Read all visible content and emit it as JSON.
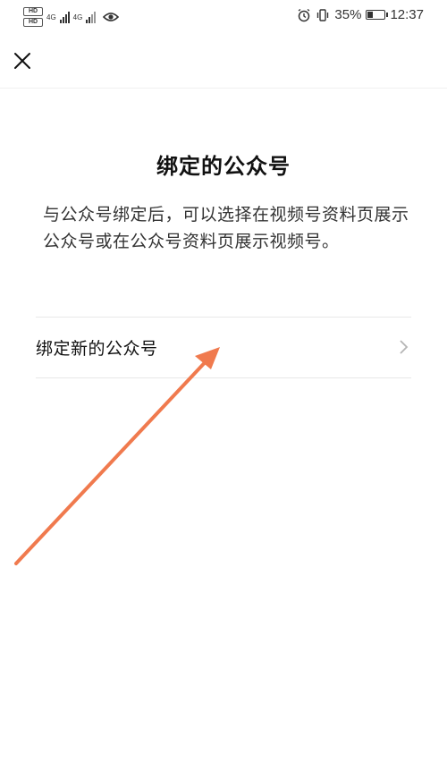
{
  "status_bar": {
    "hd_label_1": "HD",
    "hd_label_2": "HD",
    "network_1": "4G",
    "network_2": "4G",
    "battery_percent": "35%",
    "battery_level": 0.35,
    "time": "12:37",
    "icons": [
      "eye-icon",
      "alarm-icon",
      "vibrate-icon",
      "battery-icon"
    ]
  },
  "header": {
    "close_icon": "close-icon"
  },
  "main": {
    "title": "绑定的公众号",
    "description": "与公众号绑定后，可以选择在视频号资料页展示公众号或在公众号资料页展示视频号。",
    "bind_row_label": "绑定新的公众号",
    "bind_row_icon": "chevron-right-icon"
  },
  "colors": {
    "annotation_arrow": "#f07a4e",
    "divider": "#e8e8e8",
    "text_primary": "#111111",
    "text_secondary": "#333333"
  }
}
